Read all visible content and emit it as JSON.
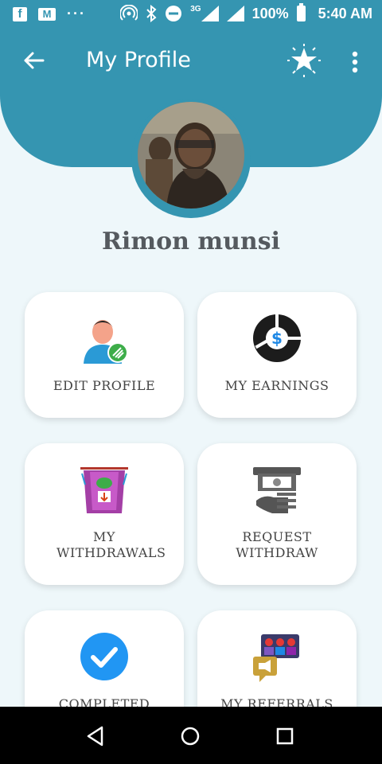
{
  "status_bar": {
    "battery": "100%",
    "time": "5:40 AM",
    "network": "3G"
  },
  "appbar": {
    "title": "My Profile"
  },
  "profile": {
    "name": "Rimon munsi"
  },
  "cards": [
    {
      "label": "EDIT PROFILE",
      "icon": "edit-profile-icon"
    },
    {
      "label": "MY EARNINGS",
      "icon": "earnings-icon"
    },
    {
      "label": "MY WITHDRAWALS",
      "icon": "withdrawals-icon"
    },
    {
      "label": "REQUEST WITHDRAW",
      "icon": "request-withdraw-icon"
    },
    {
      "label": "COMPLETED",
      "icon": "check-icon"
    },
    {
      "label": "MY REFERRALS",
      "icon": "referrals-icon"
    }
  ],
  "colors": {
    "primary": "#3595b1",
    "background": "#eef7fa"
  }
}
